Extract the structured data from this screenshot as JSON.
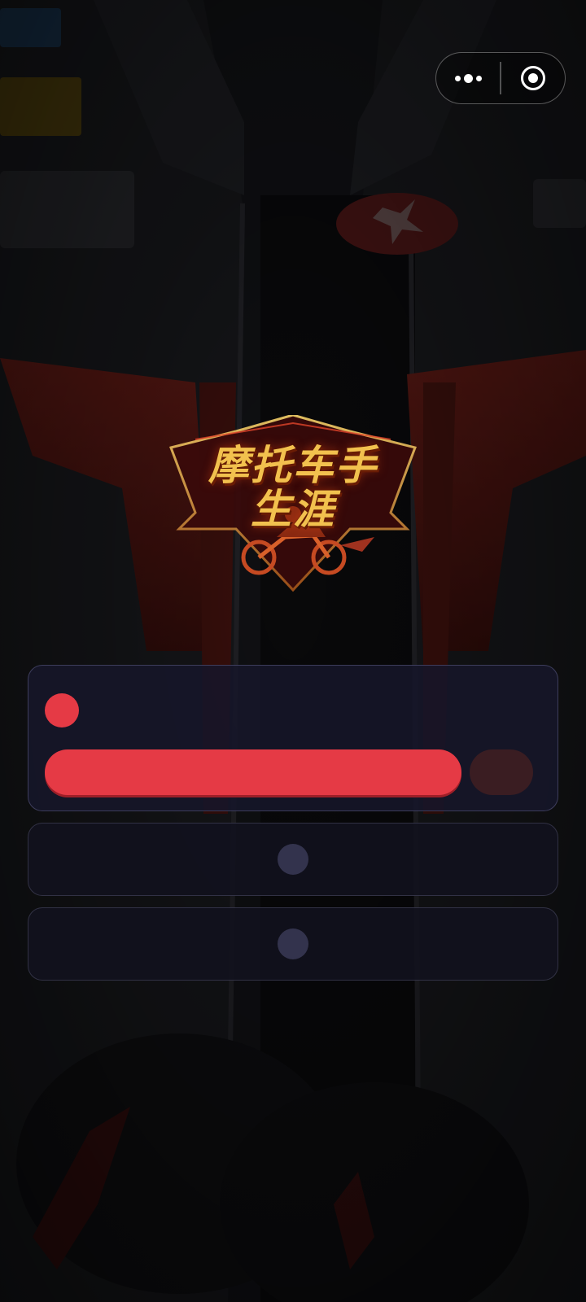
{
  "app": {
    "logo_title_line1": "摩托车手",
    "logo_title_line2": "生涯"
  },
  "capsule": {
    "more_icon": "more-dots-icon",
    "close_icon": "target-circle-icon"
  },
  "loading": {
    "progress": 0.84,
    "accent_color": "#e53a45",
    "track_color": "#3a1d22"
  },
  "options": [
    {
      "icon": "placeholder-dot-icon"
    },
    {
      "icon": "placeholder-dot-icon"
    }
  ],
  "colors": {
    "panel_bg": "#16162a",
    "row_dot": "#33334d",
    "logo_gold": "#f2c14e"
  }
}
